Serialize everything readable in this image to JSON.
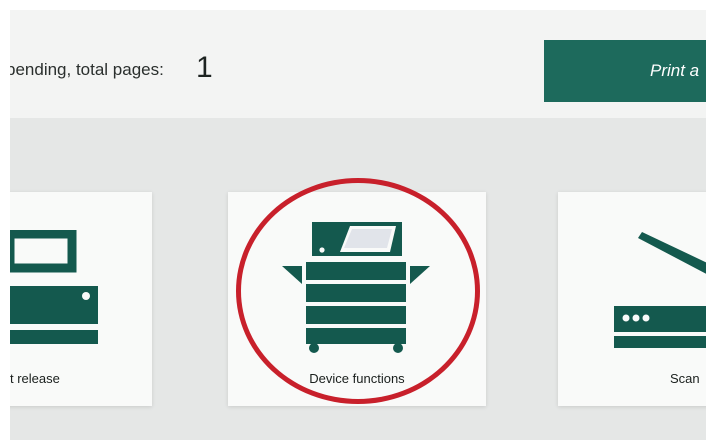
{
  "header": {
    "pending_label": "pending, total pages:",
    "pending_count": "1",
    "print_button_label": "Print a"
  },
  "tiles": {
    "release_label": "t release",
    "device_label": "Device functions",
    "scan_label": "Scan"
  },
  "colors": {
    "accent": "#1d6a5c",
    "highlight": "#c8202b"
  },
  "icons": [
    "printer-icon",
    "copier-icon",
    "scanner-icon"
  ]
}
